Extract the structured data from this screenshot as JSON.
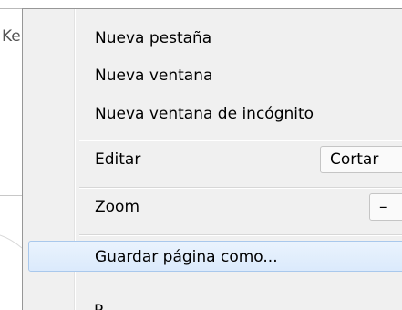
{
  "background": {
    "tab_fragment": "Ke"
  },
  "menu": {
    "new_tab": "Nueva pestaña",
    "new_window": "Nueva ventana",
    "new_incognito": "Nueva ventana de incógnito",
    "edit_label": "Editar",
    "cut_label": "Cortar",
    "zoom_label": "Zoom",
    "zoom_minus": "–",
    "save_page": "Guardar página como...",
    "next_partial": "P"
  },
  "colors": {
    "menu_bg": "#f0f0f0",
    "highlight_border": "#a9c8ec",
    "highlight_fill": "#dbeafc"
  }
}
